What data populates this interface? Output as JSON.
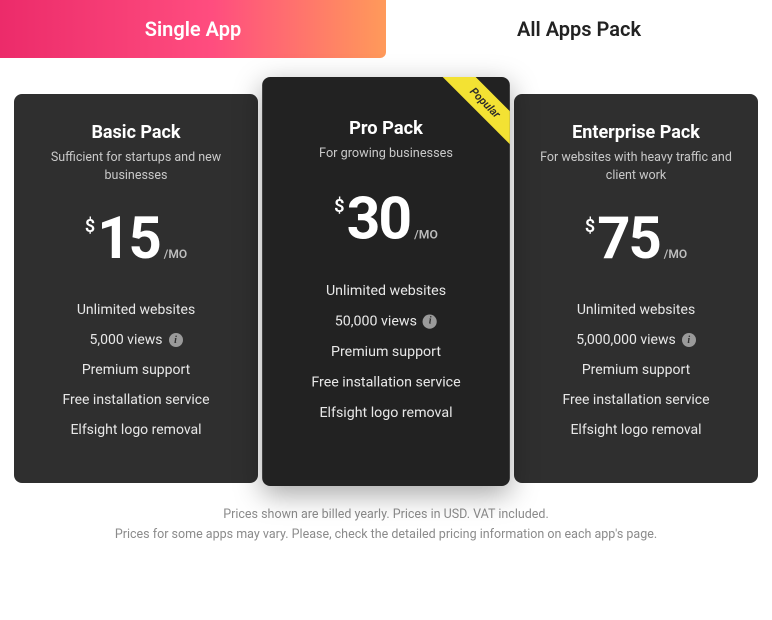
{
  "tabs": {
    "single": "Single App",
    "all": "All Apps Pack"
  },
  "ribbon": "Popular",
  "currency": "$",
  "period": "/MO",
  "plans": [
    {
      "name": "Basic Pack",
      "tagline": "Sufficient for startups and new businesses",
      "price": "15",
      "features": [
        {
          "text": "Unlimited websites",
          "info": false
        },
        {
          "text": "5,000 views",
          "info": true
        },
        {
          "text": "Premium support",
          "info": false
        },
        {
          "text": "Free installation service",
          "info": false
        },
        {
          "text": "Elfsight logo removal",
          "info": false
        }
      ]
    },
    {
      "name": "Pro Pack",
      "tagline": "For growing businesses",
      "price": "30",
      "features": [
        {
          "text": "Unlimited websites",
          "info": false
        },
        {
          "text": "50,000 views",
          "info": true
        },
        {
          "text": "Premium support",
          "info": false
        },
        {
          "text": "Free installation service",
          "info": false
        },
        {
          "text": "Elfsight logo removal",
          "info": false
        }
      ]
    },
    {
      "name": "Enterprise Pack",
      "tagline": "For websites with heavy traffic and client work",
      "price": "75",
      "features": [
        {
          "text": "Unlimited websites",
          "info": false
        },
        {
          "text": "5,000,000 views",
          "info": true
        },
        {
          "text": "Premium support",
          "info": false
        },
        {
          "text": "Free installation service",
          "info": false
        },
        {
          "text": "Elfsight logo removal",
          "info": false
        }
      ]
    }
  ],
  "footnote": {
    "line1": "Prices shown are billed yearly. Prices in USD. VAT included.",
    "line2": "Prices for some apps may vary. Please, check the detailed pricing information on each app's page."
  }
}
